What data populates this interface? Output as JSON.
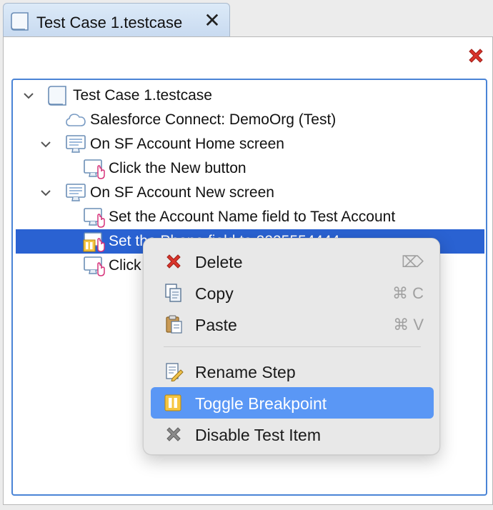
{
  "tab": {
    "title": "Test Case 1.testcase",
    "icon": "testcase-icon",
    "close_icon": "close-icon",
    "close_glyph": "✕"
  },
  "toolbar": {
    "remove_icon": "red-x-icon"
  },
  "tree": {
    "nodes": [
      {
        "label": "Test Case 1.testcase",
        "icon": "testcase-icon",
        "expanded": true
      },
      {
        "label": "Salesforce Connect: DemoOrg (Test)",
        "icon": "cloud-icon"
      },
      {
        "label": "On SF Account Home screen",
        "icon": "screen-icon",
        "expanded": true
      },
      {
        "label": "Click the New button",
        "icon": "click-step-icon"
      },
      {
        "label": "On SF Account New screen",
        "icon": "screen-icon",
        "expanded": true
      },
      {
        "label": "Set the Account Name field to Test Account",
        "icon": "click-step-icon"
      },
      {
        "label": "Set the Phone field to 2225554444",
        "icon": "breakpoint-step-icon",
        "selected": true
      },
      {
        "label": "Click the Save button",
        "icon": "click-step-icon"
      }
    ]
  },
  "context_menu": {
    "items": [
      {
        "label": "Delete",
        "icon": "delete-icon",
        "shortcut": "⌦"
      },
      {
        "label": "Copy",
        "icon": "copy-icon",
        "shortcut": "⌘ C"
      },
      {
        "label": "Paste",
        "icon": "paste-icon",
        "shortcut": "⌘ V"
      },
      {
        "label": "Rename Step",
        "icon": "rename-icon",
        "shortcut": ""
      },
      {
        "label": "Toggle Breakpoint",
        "icon": "breakpoint-icon",
        "shortcut": "",
        "highlighted": true
      },
      {
        "label": "Disable Test Item",
        "icon": "disable-icon",
        "shortcut": ""
      }
    ]
  },
  "colors": {
    "selection": "#2a62d2",
    "menu_highlight": "#5a97f5",
    "focus_border": "#4a84d6",
    "delete_red": "#d9342b"
  }
}
